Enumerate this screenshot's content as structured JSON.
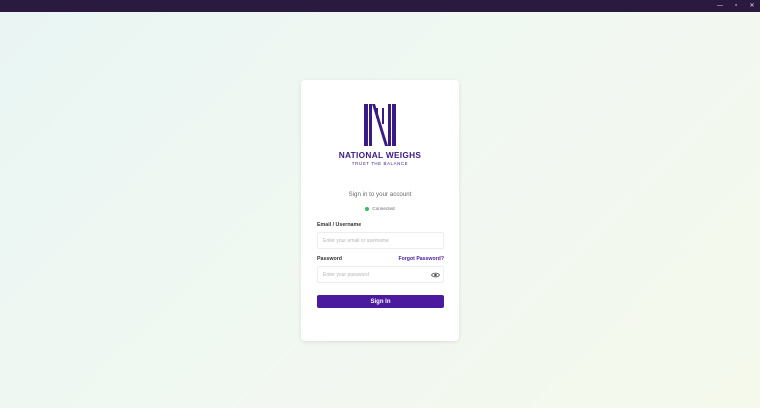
{
  "window": {
    "controls": [
      "—",
      "▫",
      "✕"
    ]
  },
  "brand": {
    "name": "NATIONAL WEIGHS",
    "tagline": "TRUST THE BALANCE",
    "color": "#3a1a86"
  },
  "login": {
    "subtitle": "Sign in to your account",
    "status": "Connected",
    "status_color": "#2fbf5b",
    "email_label": "Email / Username",
    "email_placeholder": "Enter your email or username",
    "password_label": "Password",
    "forgot_label": "Forgot Password?",
    "password_placeholder": "Enter your password",
    "submit_label": "Sign In",
    "accent": "#4c1a9e"
  }
}
